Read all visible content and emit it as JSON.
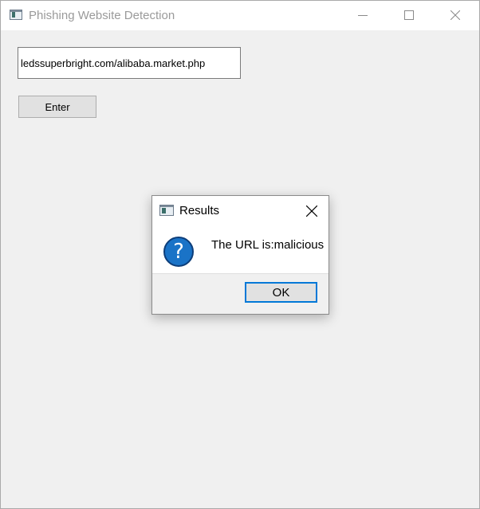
{
  "window": {
    "title": "Phishing Website Detection",
    "icon": "app-window-icon"
  },
  "form": {
    "url_value": "ledssuperbright.com/alibaba.market.php",
    "enter_label": "Enter"
  },
  "dialog": {
    "title": "Results",
    "icon": "app-window-icon",
    "message_icon": "question-icon",
    "message": "The URL is:malicious",
    "ok_label": "OK"
  },
  "colors": {
    "accent": "#0078d7",
    "question_icon_fill": "#1a73c7",
    "window_bg": "#f0f0f0"
  }
}
